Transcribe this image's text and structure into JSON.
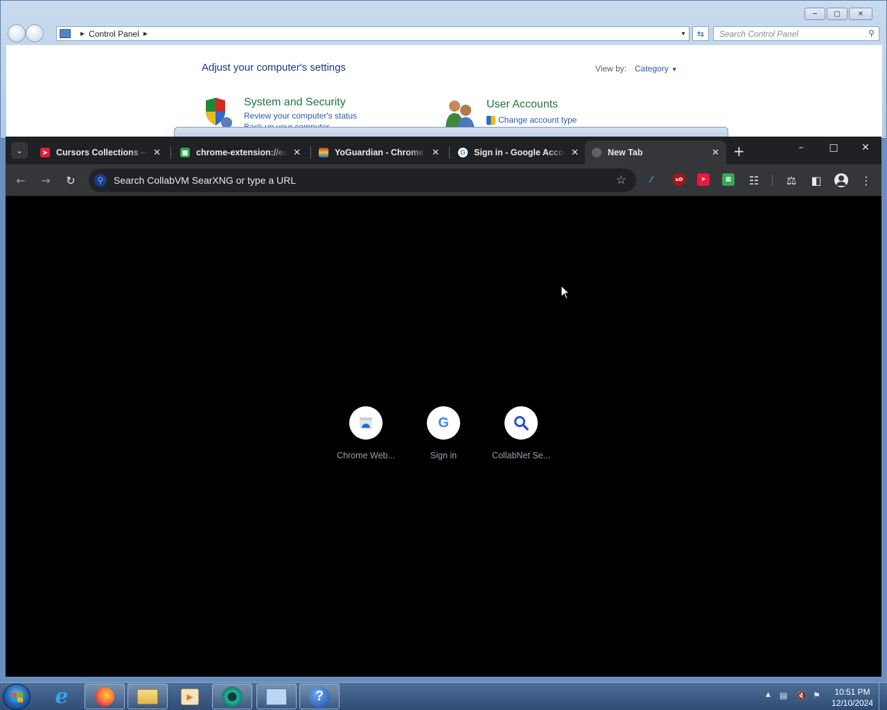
{
  "control_panel": {
    "breadcrumb": "Control Panel",
    "search_placeholder": "Search Control Panel",
    "heading": "Adjust your computer's settings",
    "view_by_label": "View by:",
    "view_by_value": "Category",
    "categories": [
      {
        "title": "System and Security",
        "link1": "Review your computer's status",
        "link2": "Back up your computer"
      },
      {
        "title": "User Accounts",
        "link1": "Change account type"
      }
    ]
  },
  "chrome": {
    "tabs": [
      {
        "title": "Cursors Collections — Custom Cursor",
        "favicon": "custom-cursor-icon",
        "color": "#e8193c"
      },
      {
        "title": "chrome-extension://eoi",
        "favicon": "extension-puzzle-icon",
        "color": "#34a853"
      },
      {
        "title": "YoGuardian - Chrome Web Store",
        "favicon": "yoguardian-icon",
        "color": "#c6372f"
      },
      {
        "title": "Sign in - Google Accounts",
        "favicon": "google-icon",
        "color": "#4285f4"
      },
      {
        "title": "New Tab",
        "favicon": "globe-icon",
        "color": "#5f6368"
      }
    ],
    "omnibox_placeholder": "Search CollabVM SearXNG or type a URL",
    "shortcuts": [
      {
        "label": "Chrome Web...",
        "icon": "chrome-web-store-icon"
      },
      {
        "label": "Sign in",
        "icon": "google-icon"
      },
      {
        "label": "CollabNet Se...",
        "icon": "search-icon"
      }
    ]
  },
  "taskbar": {
    "time": "10:51 PM",
    "date": "12/10/2024"
  }
}
